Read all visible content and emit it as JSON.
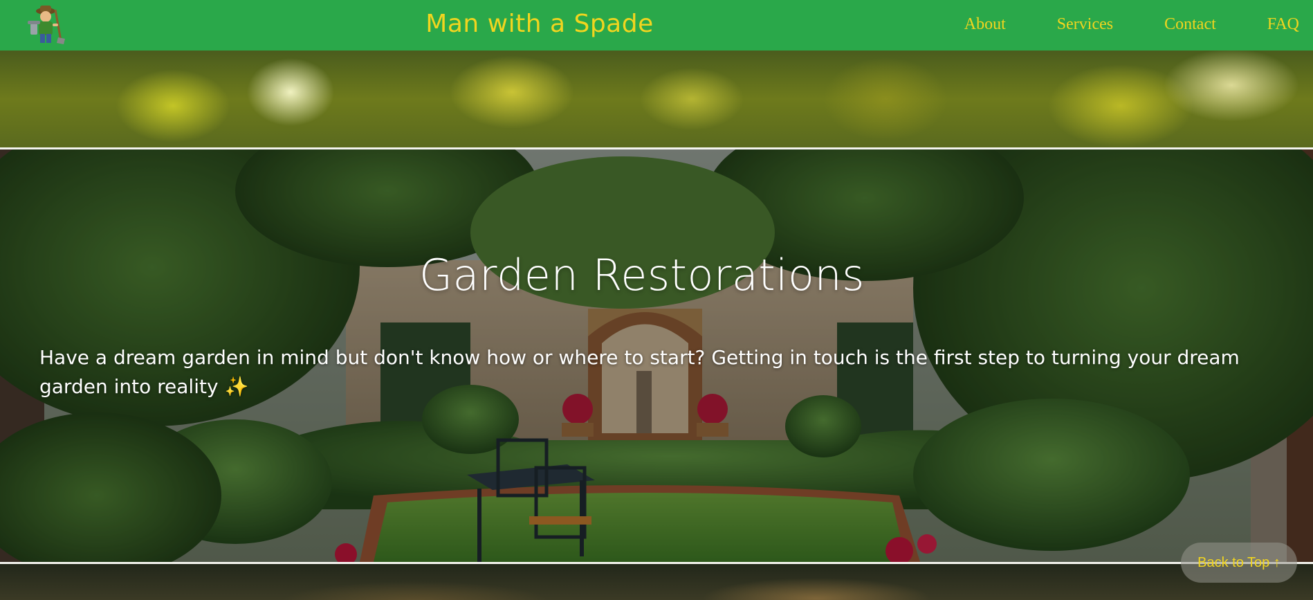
{
  "header": {
    "brand": "Man with a Spade",
    "logo_icon": "gardener-mascot-icon",
    "nav": [
      {
        "label": "About"
      },
      {
        "label": "Services"
      },
      {
        "label": "Contact"
      },
      {
        "label": "FAQ"
      }
    ]
  },
  "hero": {
    "title": "Garden Restorations",
    "description": "Have a dream garden in mind but don't know how or where to start? Getting in touch is the first step to turning your dream garden into reality",
    "emoji": "✨"
  },
  "back_to_top": {
    "label": "Back to Top ↑"
  },
  "colors": {
    "header_bg": "#2aa84a",
    "accent_yellow": "#f1d51f",
    "text_white": "#ffffff"
  }
}
